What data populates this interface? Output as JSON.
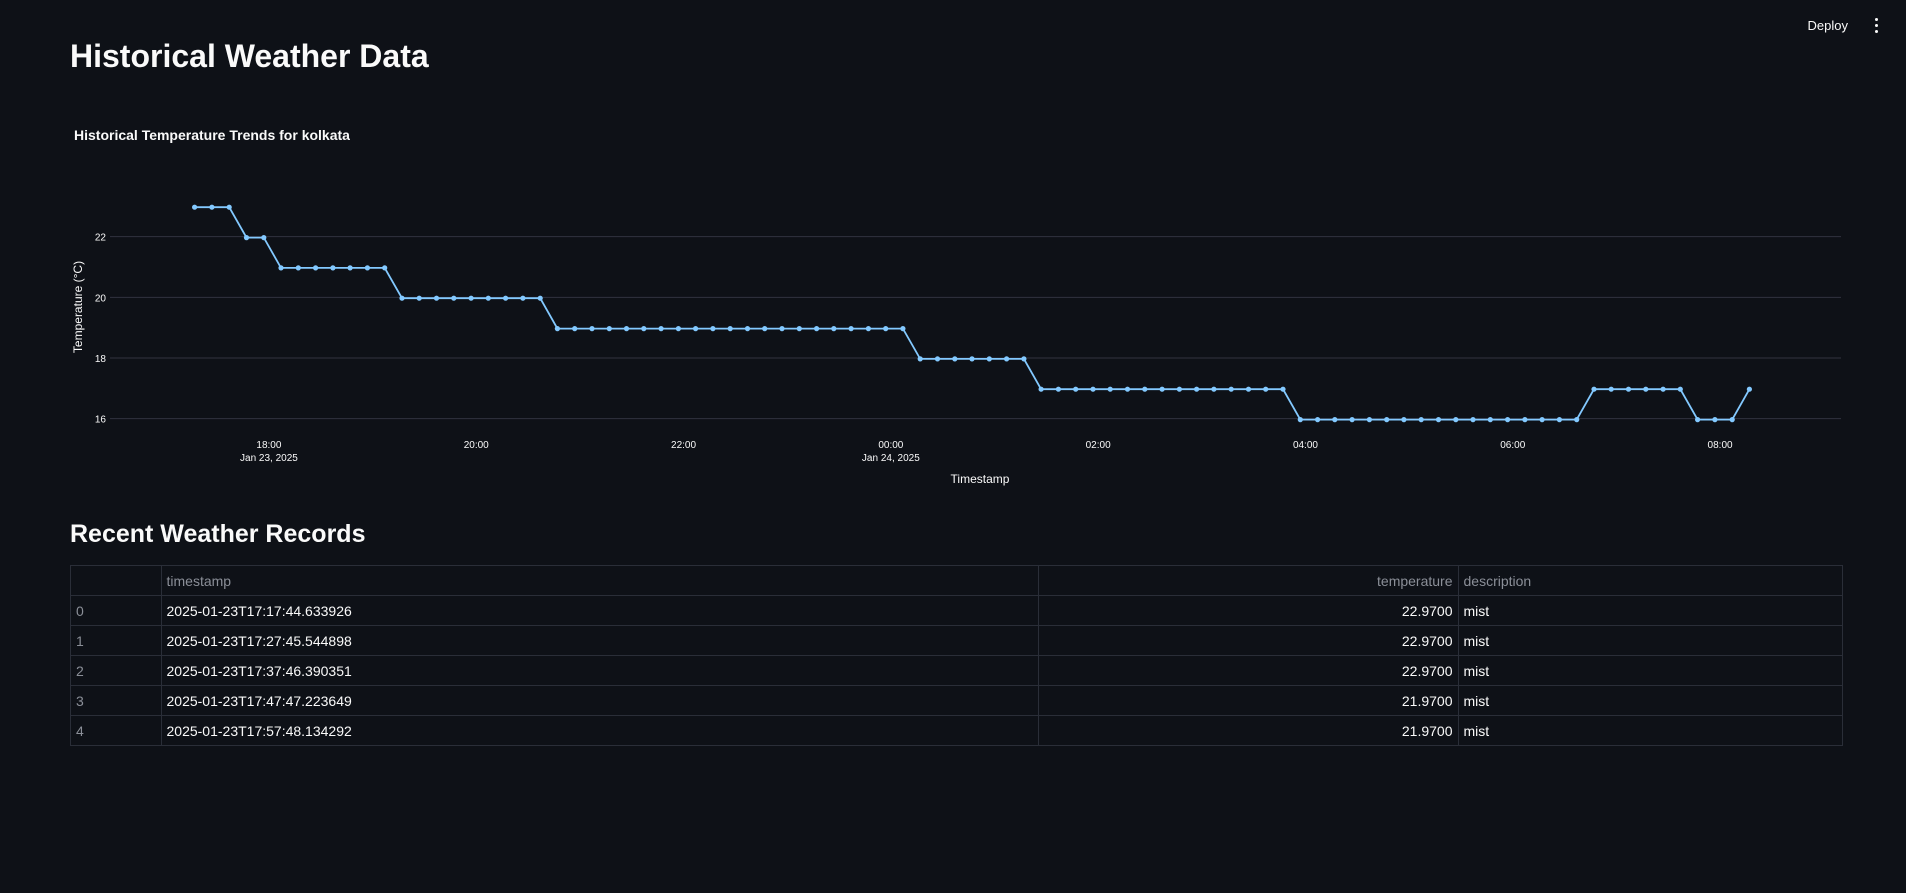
{
  "toolbar": {
    "deploy_label": "Deploy"
  },
  "page": {
    "title": "Historical Weather Data"
  },
  "chart_data": {
    "type": "line",
    "title": "Historical Temperature Trends for kolkata",
    "xlabel": "Timestamp",
    "ylabel": "Temperature (°C)",
    "x_range": [
      "2025-01-23 16:28",
      "2025-01-24 09:10"
    ],
    "ylim": [
      15.0,
      24.0
    ],
    "yticks": [
      16,
      18,
      20,
      22
    ],
    "xticks": [
      {
        "at": "2025-01-23 18:00",
        "label": "18:00",
        "sublabel": "Jan 23, 2025"
      },
      {
        "at": "2025-01-23 20:00",
        "label": "20:00",
        "sublabel": ""
      },
      {
        "at": "2025-01-23 22:00",
        "label": "22:00",
        "sublabel": ""
      },
      {
        "at": "2025-01-24 00:00",
        "label": "00:00",
        "sublabel": "Jan 24, 2025"
      },
      {
        "at": "2025-01-24 02:00",
        "label": "02:00",
        "sublabel": ""
      },
      {
        "at": "2025-01-24 04:00",
        "label": "04:00",
        "sublabel": ""
      },
      {
        "at": "2025-01-24 06:00",
        "label": "06:00",
        "sublabel": ""
      },
      {
        "at": "2025-01-24 08:00",
        "label": "08:00",
        "sublabel": ""
      }
    ],
    "grid": true,
    "line_color": "#83c9ff",
    "series": [
      {
        "x": [
          "2025-01-23 17:17",
          "2025-01-23 17:27",
          "2025-01-23 17:37",
          "2025-01-23 17:47",
          "2025-01-23 17:57",
          "2025-01-23 18:07",
          "2025-01-23 18:17",
          "2025-01-23 18:27",
          "2025-01-23 18:37",
          "2025-01-23 18:47",
          "2025-01-23 18:57",
          "2025-01-23 19:07",
          "2025-01-23 19:17",
          "2025-01-23 19:27",
          "2025-01-23 19:37",
          "2025-01-23 19:47",
          "2025-01-23 19:57",
          "2025-01-23 20:07",
          "2025-01-23 20:17",
          "2025-01-23 20:27",
          "2025-01-23 20:37",
          "2025-01-23 20:47",
          "2025-01-23 20:57",
          "2025-01-23 21:07",
          "2025-01-23 21:17",
          "2025-01-23 21:27",
          "2025-01-23 21:37",
          "2025-01-23 21:47",
          "2025-01-23 21:57",
          "2025-01-23 22:07",
          "2025-01-23 22:17",
          "2025-01-23 22:27",
          "2025-01-23 22:37",
          "2025-01-23 22:47",
          "2025-01-23 22:57",
          "2025-01-23 23:07",
          "2025-01-23 23:17",
          "2025-01-23 23:27",
          "2025-01-23 23:37",
          "2025-01-23 23:47",
          "2025-01-23 23:57",
          "2025-01-24 00:07",
          "2025-01-24 00:17",
          "2025-01-24 00:27",
          "2025-01-24 00:37",
          "2025-01-24 00:47",
          "2025-01-24 00:57",
          "2025-01-24 01:07",
          "2025-01-24 01:17",
          "2025-01-24 01:27",
          "2025-01-24 01:37",
          "2025-01-24 01:47",
          "2025-01-24 01:57",
          "2025-01-24 02:07",
          "2025-01-24 02:17",
          "2025-01-24 02:27",
          "2025-01-24 02:37",
          "2025-01-24 02:47",
          "2025-01-24 02:57",
          "2025-01-24 03:07",
          "2025-01-24 03:17",
          "2025-01-24 03:27",
          "2025-01-24 03:37",
          "2025-01-24 03:47",
          "2025-01-24 03:57",
          "2025-01-24 04:07",
          "2025-01-24 04:17",
          "2025-01-24 04:27",
          "2025-01-24 04:37",
          "2025-01-24 04:47",
          "2025-01-24 04:57",
          "2025-01-24 05:07",
          "2025-01-24 05:17",
          "2025-01-24 05:27",
          "2025-01-24 05:37",
          "2025-01-24 05:47",
          "2025-01-24 05:57",
          "2025-01-24 06:07",
          "2025-01-24 06:17",
          "2025-01-24 06:27",
          "2025-01-24 06:37",
          "2025-01-24 06:47",
          "2025-01-24 06:57",
          "2025-01-24 07:07",
          "2025-01-24 07:17",
          "2025-01-24 07:27",
          "2025-01-24 07:37",
          "2025-01-24 07:47",
          "2025-01-24 07:57",
          "2025-01-24 08:07",
          "2025-01-24 08:17"
        ],
        "y": [
          22.97,
          22.97,
          22.97,
          21.97,
          21.97,
          20.97,
          20.97,
          20.97,
          20.97,
          20.97,
          20.97,
          20.97,
          19.97,
          19.97,
          19.97,
          19.97,
          19.97,
          19.97,
          19.97,
          19.97,
          19.97,
          18.97,
          18.97,
          18.97,
          18.97,
          18.97,
          18.97,
          18.97,
          18.97,
          18.97,
          18.97,
          18.97,
          18.97,
          18.97,
          18.97,
          18.97,
          18.97,
          18.97,
          18.97,
          18.97,
          18.97,
          18.97,
          17.97,
          17.97,
          17.97,
          17.97,
          17.97,
          17.97,
          17.97,
          16.97,
          16.97,
          16.97,
          16.97,
          16.97,
          16.97,
          16.97,
          16.97,
          16.97,
          16.97,
          16.97,
          16.97,
          16.97,
          16.97,
          16.97,
          15.97,
          15.97,
          15.97,
          15.97,
          15.97,
          15.97,
          15.97,
          15.97,
          15.97,
          15.97,
          15.97,
          15.97,
          15.97,
          15.97,
          15.97,
          15.97,
          15.97,
          16.97,
          16.97,
          16.97,
          16.97,
          16.97,
          16.97,
          15.97,
          15.97,
          15.97,
          16.97
        ]
      }
    ]
  },
  "records": {
    "title": "Recent Weather Records",
    "columns": [
      "",
      "timestamp",
      "temperature",
      "description"
    ],
    "rows": [
      [
        "0",
        "2025-01-23T17:17:44.633926",
        "22.9700",
        "mist"
      ],
      [
        "1",
        "2025-01-23T17:27:45.544898",
        "22.9700",
        "mist"
      ],
      [
        "2",
        "2025-01-23T17:37:46.390351",
        "22.9700",
        "mist"
      ],
      [
        "3",
        "2025-01-23T17:47:47.223649",
        "21.9700",
        "mist"
      ],
      [
        "4",
        "2025-01-23T17:57:48.134292",
        "21.9700",
        "mist"
      ]
    ]
  }
}
